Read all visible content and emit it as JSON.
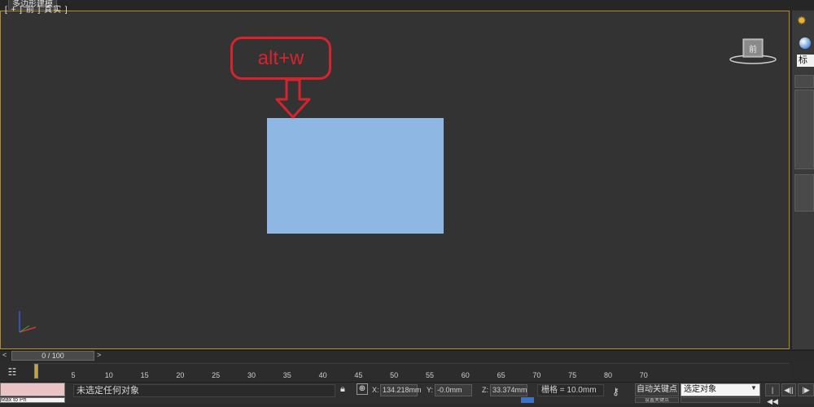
{
  "tabs": {
    "active_tab": "多边形建模"
  },
  "viewport": {
    "label": "[ + ] 前 ] 真实 ]",
    "object_color": "#8fb7e4",
    "border_color": "#b58a2c",
    "background": "#333333",
    "annotation": {
      "text": "alt+w",
      "color": "#d6242f"
    },
    "viewcube_label": "前"
  },
  "command_panel": {
    "standard_field": "标准"
  },
  "timeline": {
    "slider_text": "0 / 100",
    "prev_label": "<",
    "next_label": ">",
    "ticks": [
      "5",
      "10",
      "15",
      "20",
      "25",
      "30",
      "35",
      "40",
      "45",
      "50",
      "55",
      "60",
      "65",
      "70",
      "75",
      "80",
      "70"
    ]
  },
  "status": {
    "maxscript_text": "Max to Ph",
    "prompt": "未选定任何对象",
    "x_label": "X:",
    "x_value": "134.218mm",
    "y_label": "Y:",
    "y_value": "-0.0mm",
    "z_label": "Z:",
    "z_value": "33.374mm",
    "grid": "栅格 = 10.0mm",
    "autokey_label": "自动关键点",
    "setkey_label": "设置关键点",
    "selection_dropdown": "选定对象",
    "playback": [
      "|◀◀",
      "◀||",
      "|▶"
    ]
  }
}
